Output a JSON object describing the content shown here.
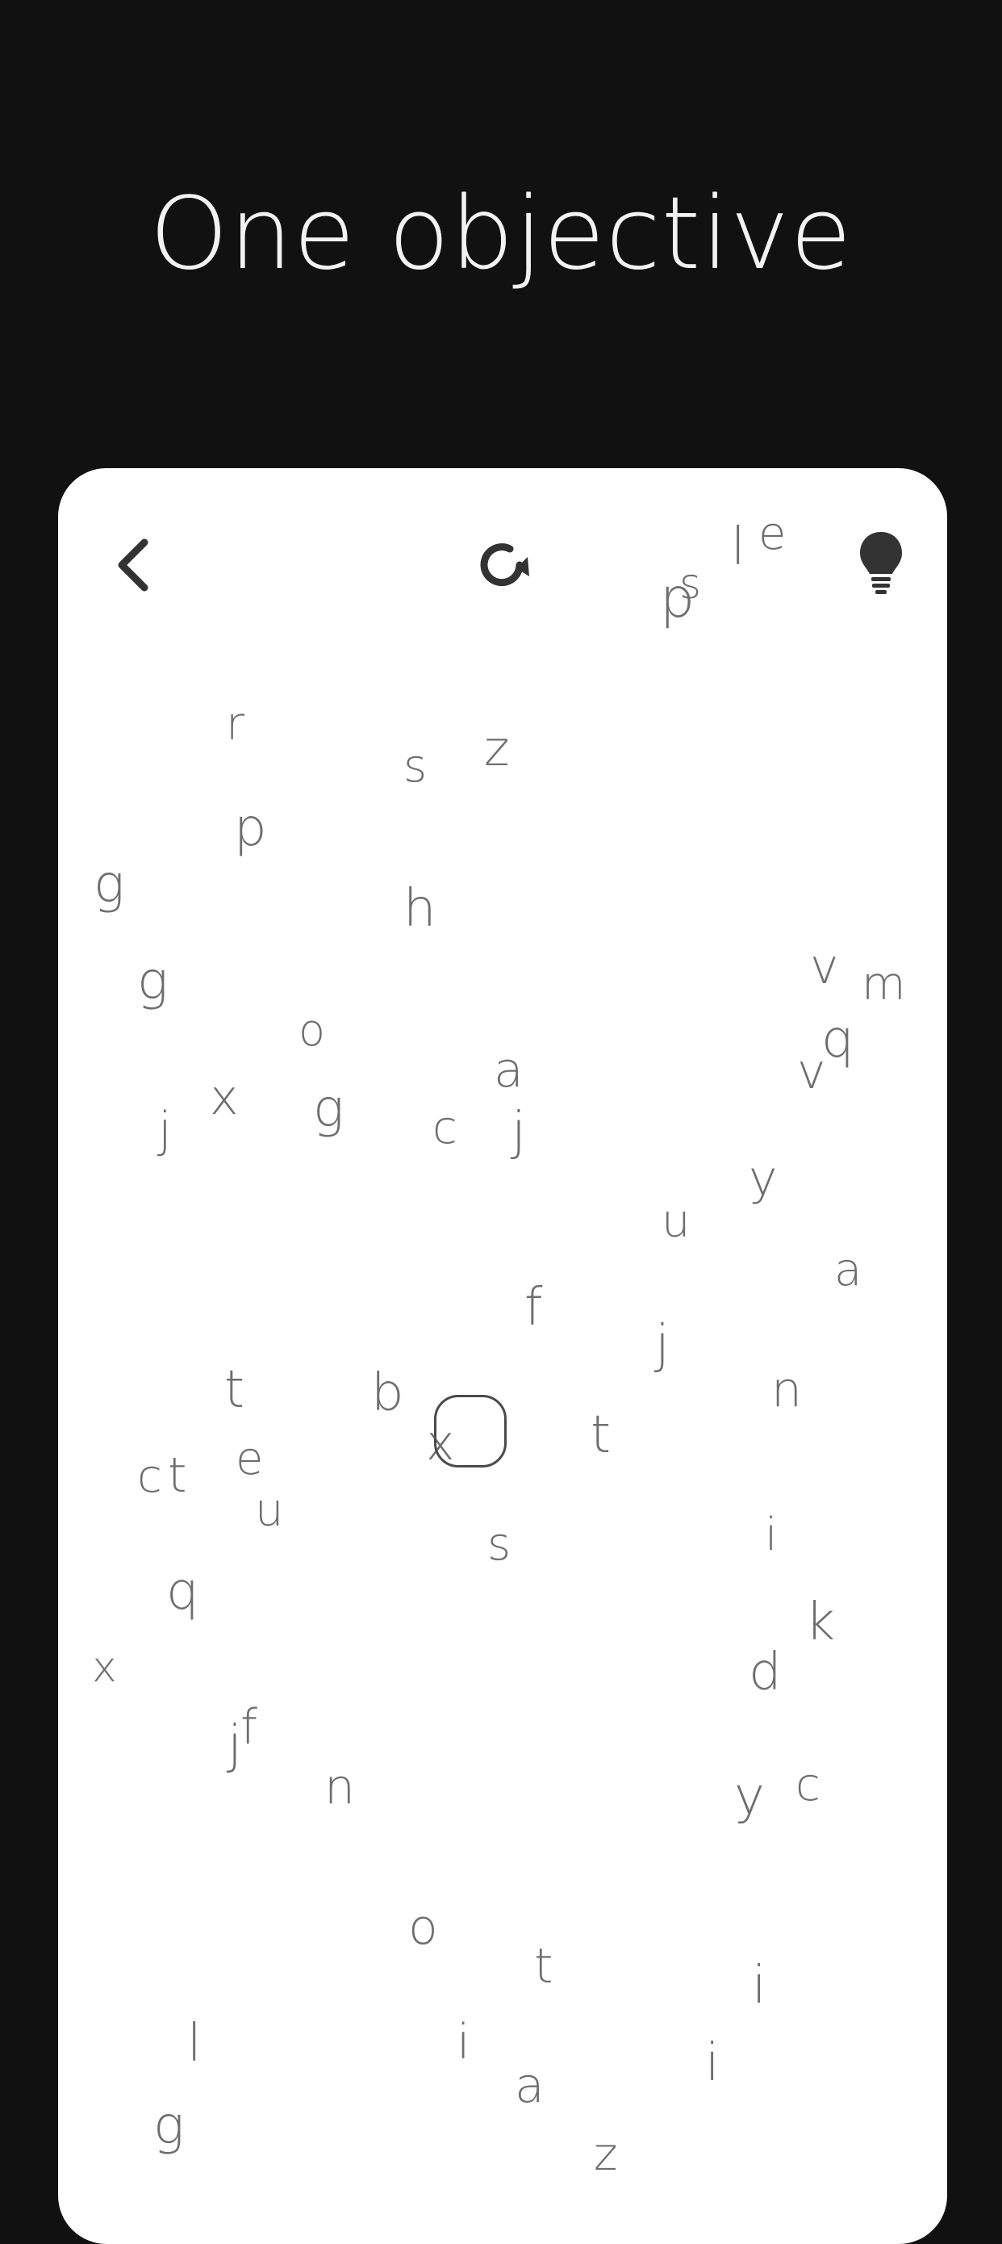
{
  "header": {
    "title": "One objective"
  },
  "toolbar": {
    "back_icon": "chevron-left-icon",
    "reset_icon": "refresh-icon",
    "hint_icon": "lightbulb-icon"
  },
  "colors": {
    "background": "#111112",
    "card": "#ffffff",
    "letters": "#6e6e6e",
    "icons": "#333333"
  },
  "board": {
    "letters": [
      "l",
      "e",
      "p",
      "s",
      "r",
      "s",
      "z",
      "p",
      "g",
      "h",
      "v",
      "m",
      "g",
      "q",
      "o",
      "v",
      "x",
      "a",
      "j",
      "g",
      "c",
      "j",
      "y",
      "u",
      "a",
      "f",
      "j",
      "t",
      "b",
      "n",
      "x",
      "t",
      "c",
      "t",
      "e",
      "u",
      "s",
      "i",
      "q",
      "k",
      "x",
      "d",
      "j",
      "f",
      "n",
      "y",
      "c",
      "o",
      "t",
      "i",
      "l",
      "i",
      "i",
      "a",
      "g",
      "z"
    ]
  }
}
